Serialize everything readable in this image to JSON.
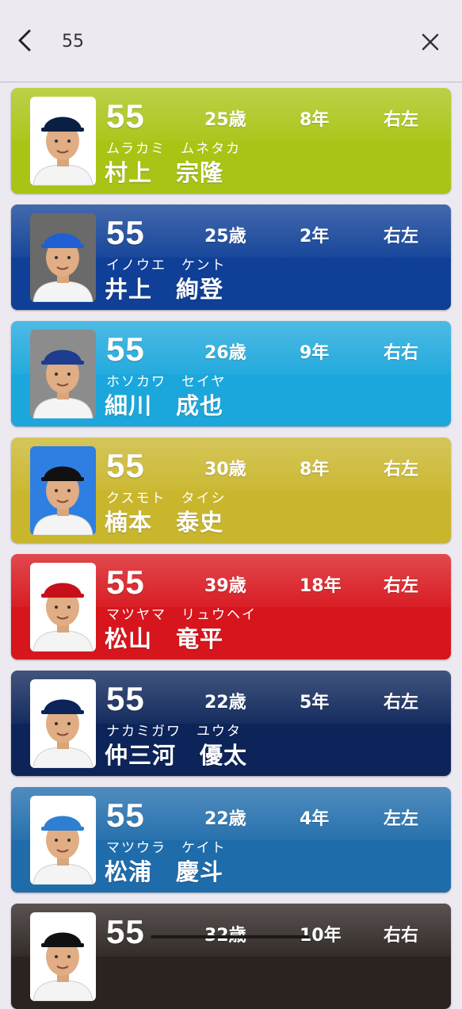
{
  "header": {
    "query": "55",
    "back_icon": "chevron-left-icon",
    "close_icon": "close-icon"
  },
  "players": [
    {
      "number": "55",
      "age": "25歳",
      "years": "8年",
      "hand": "右左",
      "kana": "ムラカミ　ムネタカ",
      "name": "村上　宗隆",
      "color": "#a9c414",
      "photo_bg": "#ffffff",
      "cap": "#0a1f44",
      "uniform": "#f4f4f4"
    },
    {
      "number": "55",
      "age": "25歳",
      "years": "2年",
      "hand": "右左",
      "kana": "イノウエ　ケント",
      "name": "井上　絢登",
      "color": "#0f3f96",
      "photo_bg": "#6a6a6a",
      "cap": "#1f5fd1",
      "uniform": "#f4f4f4"
    },
    {
      "number": "55",
      "age": "26歳",
      "years": "9年",
      "hand": "右右",
      "kana": "ホソカワ　セイヤ",
      "name": "細川　成也",
      "color": "#1ba7dc",
      "photo_bg": "#8c8c8c",
      "cap": "#1d3c8f",
      "uniform": "#f4f4f4"
    },
    {
      "number": "55",
      "age": "30歳",
      "years": "8年",
      "hand": "右左",
      "kana": "クスモト　タイシ",
      "name": "楠本　泰史",
      "color": "#c9b62c",
      "photo_bg": "#2f7fe2",
      "cap": "#111111",
      "uniform": "#f4f4f4"
    },
    {
      "number": "55",
      "age": "39歳",
      "years": "18年",
      "hand": "右左",
      "kana": "マツヤマ　リュウヘイ",
      "name": "松山　竜平",
      "color": "#d7151c",
      "photo_bg": "#ffffff",
      "cap": "#c8101a",
      "uniform": "#f4f4f4"
    },
    {
      "number": "55",
      "age": "22歳",
      "years": "5年",
      "hand": "右左",
      "kana": "ナカミガワ　ユウタ",
      "name": "仲三河　優太",
      "color": "#0c2459",
      "photo_bg": "#ffffff",
      "cap": "#0c2459",
      "uniform": "#f4f4f4"
    },
    {
      "number": "55",
      "age": "22歳",
      "years": "4年",
      "hand": "左左",
      "kana": "マツウラ　ケイト",
      "name": "松浦　慶斗",
      "color": "#1f6cab",
      "photo_bg": "#ffffff",
      "cap": "#2e7fd1",
      "uniform": "#f4f4f4"
    },
    {
      "number": "55",
      "age": "32歳",
      "years": "10年",
      "hand": "右右",
      "kana": "",
      "name": "",
      "color": "#2b2320",
      "photo_bg": "#ffffff",
      "cap": "#111111",
      "uniform": "#f4f4f4"
    }
  ]
}
